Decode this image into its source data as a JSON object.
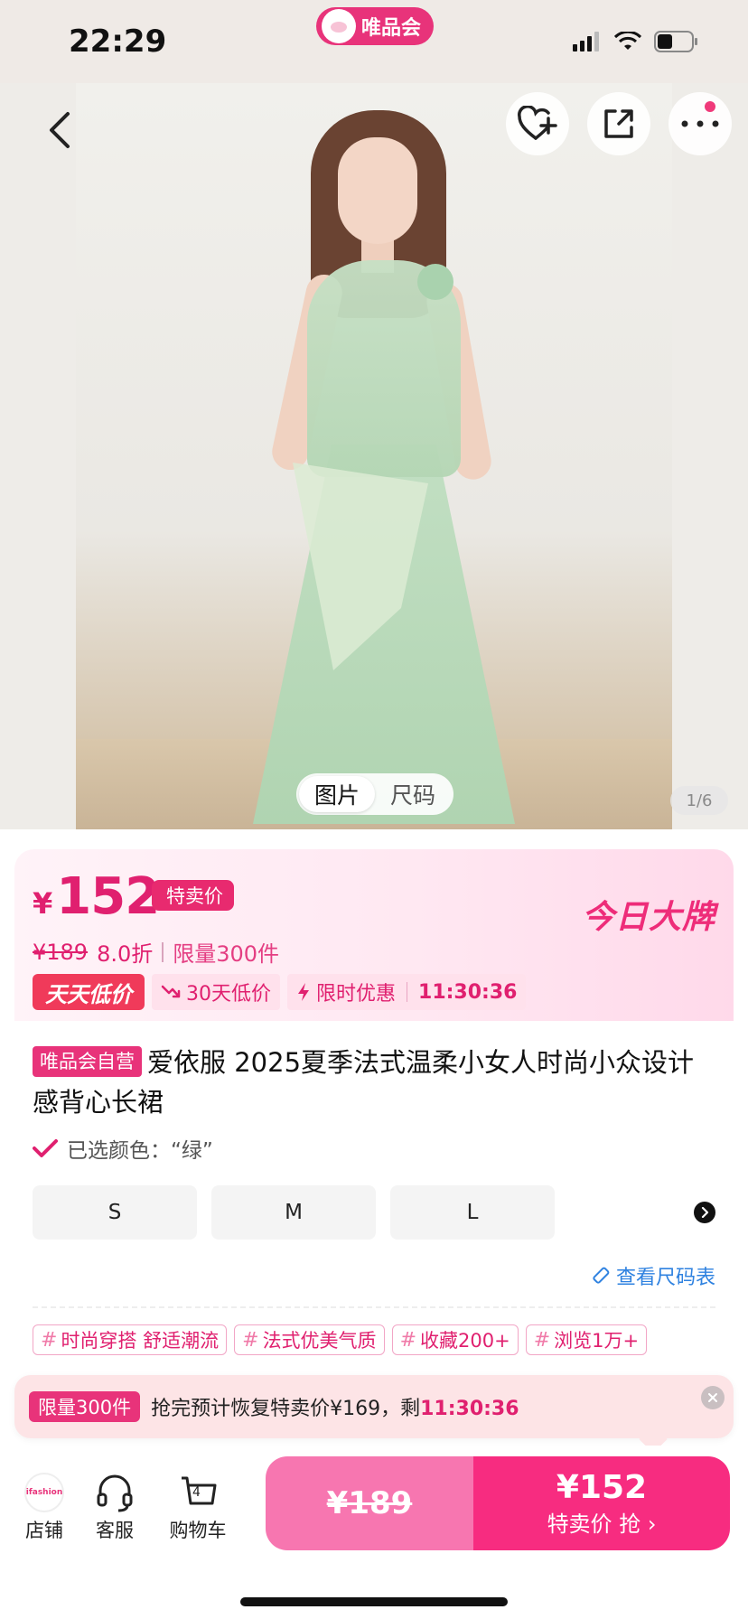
{
  "status_bar": {
    "time": "22:29",
    "brand": "唯品会"
  },
  "hero": {
    "tabs": [
      "图片",
      "尺码"
    ],
    "active_tab": 0,
    "page_indicator": "1/6"
  },
  "price": {
    "currency": "¥",
    "value": "152",
    "badge": "特卖价",
    "original": "¥189",
    "discount": "8.0折",
    "limit": "限量300件",
    "brand_banner": "今日大牌",
    "promos": {
      "everyday": "天天低价",
      "low30": "30天低价",
      "flash": "限时优惠",
      "countdown": "11:30:36"
    }
  },
  "product": {
    "self_badge": "唯品会自营",
    "title": "爱依服 2025夏季法式温柔小女人时尚小众设计感背心长裙",
    "selected_color": "已选颜色：“绿”",
    "sizes": [
      "S",
      "M",
      "L"
    ],
    "size_chart": "查看尺码表",
    "tags": [
      "时尚穿搭 舒适潮流",
      "法式优美气质",
      "收藏200+",
      "浏览1万+"
    ]
  },
  "banner": {
    "badge": "限量300件",
    "message": "抢完预计恢复特卖价¥169，剩",
    "countdown": "11:30:36"
  },
  "bottom_bar": {
    "store": "店铺",
    "service": "客服",
    "cart": "购物车",
    "cart_count": "4",
    "orig_price": "¥189",
    "buy_price": "¥152",
    "buy_label": "特卖价 抢 ›"
  },
  "colors": {
    "accent": "#e8337a",
    "price": "#e0206f"
  }
}
